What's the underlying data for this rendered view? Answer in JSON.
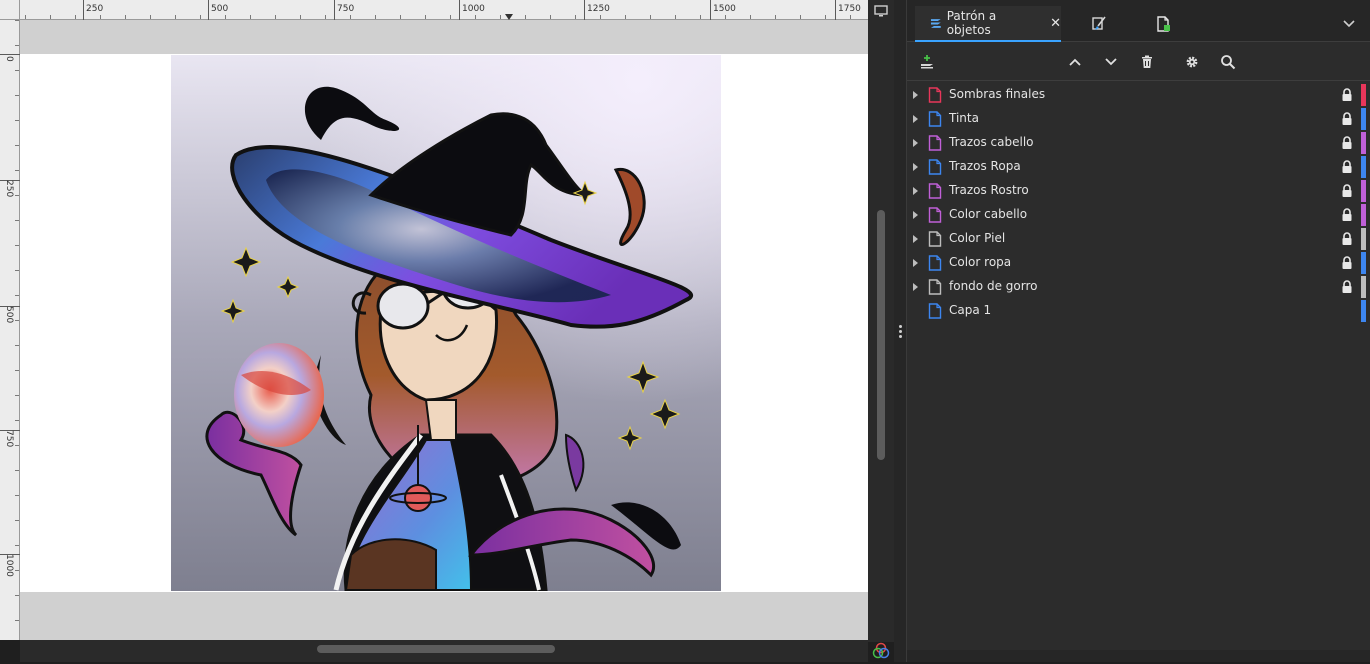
{
  "rulers": {
    "horizontal_labels": [
      "250",
      "500",
      "750",
      "1000",
      "1250",
      "1500",
      "1750"
    ],
    "vertical_labels": [
      "0",
      "250",
      "500",
      "750",
      "1000"
    ]
  },
  "panel": {
    "active_tab": {
      "label": "Patrón a objetos",
      "close_glyph": "✕"
    },
    "other_tabs": [
      "paintbrush-icon",
      "document-icon"
    ],
    "toolbar": {
      "icons": [
        "add-layer-icon",
        "move-up-icon",
        "move-down-icon",
        "trash-icon",
        "settings-gear-icon",
        "search-icon"
      ],
      "search_value": ""
    },
    "layers": [
      {
        "name": "Sombras finales",
        "icon_color": "#e8365a",
        "bar_color": "#e8365a",
        "expandable": true,
        "locked": true
      },
      {
        "name": "Tinta",
        "icon_color": "#3d86f0",
        "bar_color": "#3d86f0",
        "expandable": true,
        "locked": true
      },
      {
        "name": "Trazos cabello",
        "icon_color": "#c060d8",
        "bar_color": "#c060d8",
        "expandable": true,
        "locked": true
      },
      {
        "name": "Trazos Ropa",
        "icon_color": "#3d86f0",
        "bar_color": "#3d86f0",
        "expandable": true,
        "locked": true
      },
      {
        "name": "Trazos Rostro",
        "icon_color": "#c060d8",
        "bar_color": "#c060d8",
        "expandable": true,
        "locked": true
      },
      {
        "name": "Color cabello",
        "icon_color": "#c060d8",
        "bar_color": "#c060d8",
        "expandable": true,
        "locked": true
      },
      {
        "name": "Color Piel",
        "icon_color": "#bdbdbd",
        "bar_color": "#bdbdbd",
        "expandable": true,
        "locked": true
      },
      {
        "name": "Color ropa",
        "icon_color": "#3d86f0",
        "bar_color": "#3d86f0",
        "expandable": true,
        "locked": true
      },
      {
        "name": "fondo de gorro",
        "icon_color": "#bdbdbd",
        "bar_color": "#bdbdbd",
        "expandable": true,
        "locked": true
      },
      {
        "name": "Capa 1",
        "icon_color": "#3d86f0",
        "bar_color": "#3d86f0",
        "expandable": false,
        "locked": false
      }
    ]
  },
  "colors": {
    "accent": "#3aa3ff",
    "panel_bg": "#2c2c2c",
    "canvas_bg": "#d0d0d0"
  }
}
